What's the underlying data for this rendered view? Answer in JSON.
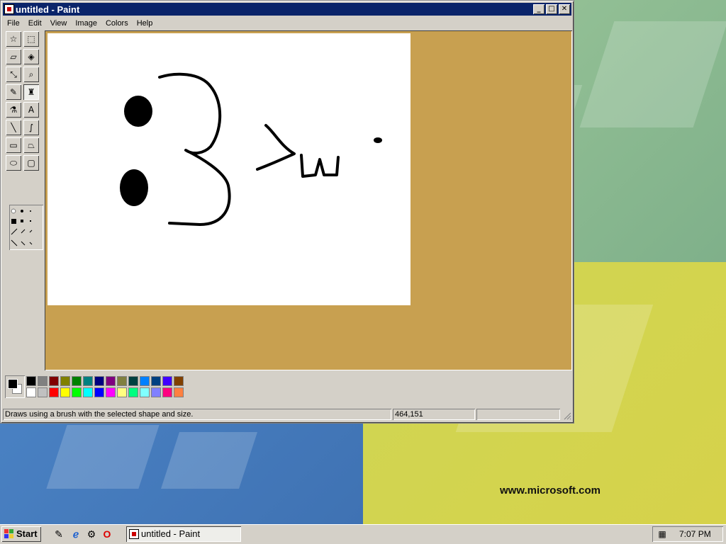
{
  "window": {
    "title": "untitled - Paint",
    "controls": {
      "minimize": "_",
      "maximize": "□",
      "close": "✕"
    }
  },
  "menu": [
    "File",
    "Edit",
    "View",
    "Image",
    "Colors",
    "Help"
  ],
  "tools": [
    {
      "name": "free-form-select-icon",
      "glyph": "☆"
    },
    {
      "name": "select-icon",
      "glyph": "⬚"
    },
    {
      "name": "eraser-icon",
      "glyph": "▱"
    },
    {
      "name": "fill-with-color-icon",
      "glyph": "◈"
    },
    {
      "name": "pick-color-icon",
      "glyph": "⤡"
    },
    {
      "name": "magnifier-icon",
      "glyph": "⌕"
    },
    {
      "name": "pencil-icon",
      "glyph": "✎"
    },
    {
      "name": "brush-icon",
      "glyph": "♜",
      "pressed": true
    },
    {
      "name": "airbrush-icon",
      "glyph": "⚗"
    },
    {
      "name": "text-icon",
      "glyph": "A"
    },
    {
      "name": "line-icon",
      "glyph": "╲"
    },
    {
      "name": "curve-icon",
      "glyph": "∫"
    },
    {
      "name": "rectangle-icon",
      "glyph": "▭"
    },
    {
      "name": "polygon-icon",
      "glyph": "⏢"
    },
    {
      "name": "ellipse-icon",
      "glyph": "⬭"
    },
    {
      "name": "rounded-rectangle-icon",
      "glyph": "▢"
    }
  ],
  "palette": {
    "foreground": "#000000",
    "background": "#ffffff",
    "top_row": [
      "#000000",
      "#808080",
      "#800000",
      "#808000",
      "#008000",
      "#008080",
      "#000080",
      "#800080",
      "#808040",
      "#004040",
      "#0080ff",
      "#004080",
      "#4000ff",
      "#804000"
    ],
    "bottom_row": [
      "#ffffff",
      "#c0c0c0",
      "#ff0000",
      "#ffff00",
      "#00ff00",
      "#00ffff",
      "#0000ff",
      "#ff00ff",
      "#ffff80",
      "#00ff80",
      "#80ffff",
      "#8080ff",
      "#ff0080",
      "#ff8040"
    ]
  },
  "status": {
    "hint": "Draws using a brush with the selected shape and size.",
    "coords": "464,151"
  },
  "desktop": {
    "url": "www.microsoft.com"
  },
  "taskbar": {
    "start": "Start",
    "quick_launch": [
      {
        "name": "show-desktop-icon",
        "glyph": "✎"
      },
      {
        "name": "internet-explorer-icon",
        "glyph": "ℯ"
      },
      {
        "name": "channels-icon",
        "glyph": "⚙"
      },
      {
        "name": "opera-icon",
        "glyph": "O"
      }
    ],
    "task_button": "untitled - Paint",
    "clock": "7:07 PM"
  }
}
